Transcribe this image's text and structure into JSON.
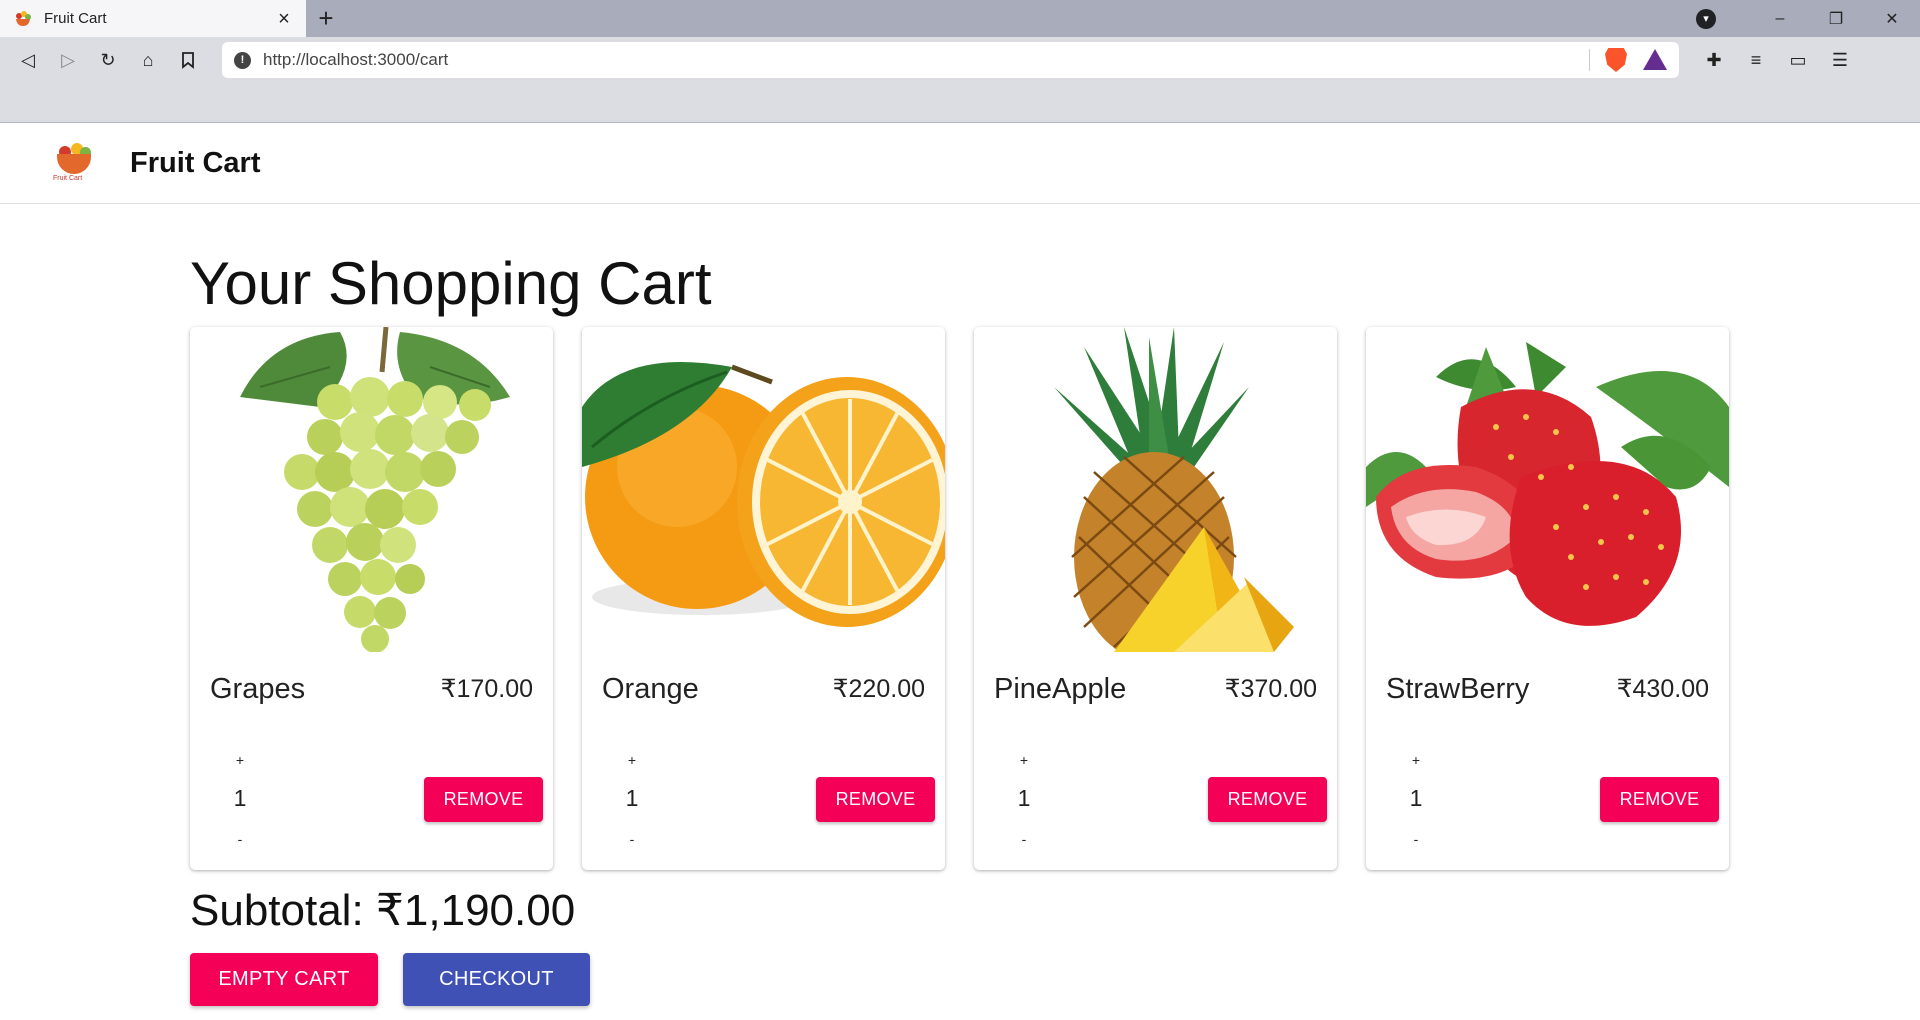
{
  "browser": {
    "tab_title": "Fruit Cart",
    "new_tab": "+",
    "url": "http://localhost:3000/cart",
    "window_controls": {
      "minimize": "–",
      "restore": "❐",
      "close": "✕"
    }
  },
  "app": {
    "title": "Fruit Cart",
    "logo_text": "Fruit Cart"
  },
  "page": {
    "heading": "Your Shopping Cart",
    "subtotal": "Subtotal: ₹1,190.00",
    "empty_cart_label": "EMPTY CART",
    "checkout_label": "CHECKOUT"
  },
  "cart": {
    "items": [
      {
        "name": "Grapes",
        "price": "₹170.00",
        "quantity": "1",
        "plus": "+",
        "minus": "-",
        "remove_label": "REMOVE",
        "image": "grapes"
      },
      {
        "name": "Orange",
        "price": "₹220.00",
        "quantity": "1",
        "plus": "+",
        "minus": "-",
        "remove_label": "REMOVE",
        "image": "orange"
      },
      {
        "name": "PineApple",
        "price": "₹370.00",
        "quantity": "1",
        "plus": "+",
        "minus": "-",
        "remove_label": "REMOVE",
        "image": "pineapple"
      },
      {
        "name": "StrawBerry",
        "price": "₹430.00",
        "quantity": "1",
        "plus": "+",
        "minus": "-",
        "remove_label": "REMOVE",
        "image": "strawberry"
      }
    ]
  },
  "colors": {
    "accent_pink": "#f50057",
    "accent_indigo": "#3f51b5"
  }
}
